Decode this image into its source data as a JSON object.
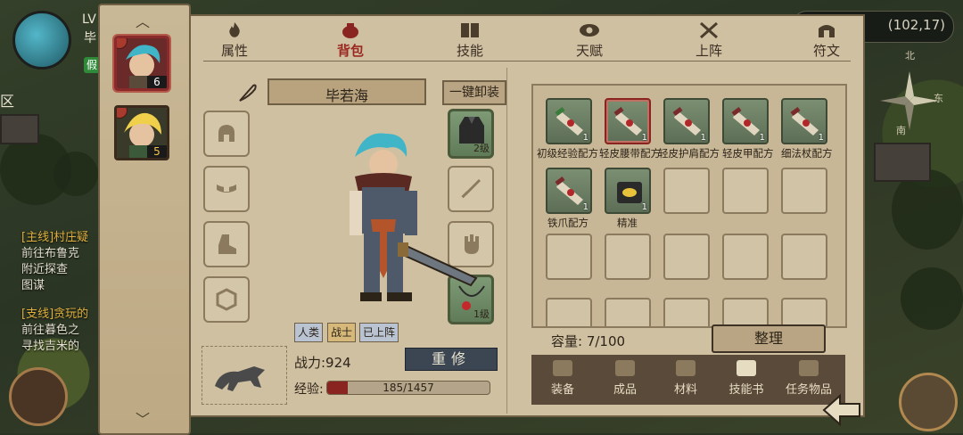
{
  "hud": {
    "level_prefix": "LV",
    "name_fragment": "毕",
    "badge": "假",
    "area": "区",
    "quests": [
      {
        "tag": "[主线]村庄疑",
        "line1": "前往布鲁克",
        "line2": "附近探查",
        "line3": "图谋"
      },
      {
        "tag": "[支线]贪玩的",
        "line1": "前往暮色之",
        "line2": "寻找吉米的"
      }
    ],
    "coords": "(102,17)",
    "compass": {
      "north": "北",
      "east": "东",
      "south": "南"
    }
  },
  "characters": [
    {
      "level": "6",
      "selected": true
    },
    {
      "level": "5",
      "selected": false
    }
  ],
  "tabs": [
    {
      "label": "属性",
      "icon": "flame-icon"
    },
    {
      "label": "背包",
      "icon": "bag-icon",
      "active": true
    },
    {
      "label": "技能",
      "icon": "book-icon"
    },
    {
      "label": "天赋",
      "icon": "eye-icon"
    },
    {
      "label": "上阵",
      "icon": "crossed-swords-icon"
    },
    {
      "label": "符文",
      "icon": "rune-gate-icon"
    }
  ],
  "hero": {
    "name": "毕若海",
    "unequip_label": "一键卸装",
    "tags": {
      "race": "人类",
      "class": "战士",
      "status": "已上阵"
    },
    "power": "战力:924",
    "reforge_label": "重修",
    "exp_label": "经验:",
    "exp_text": "185/1457",
    "exp_ratio": 0.127,
    "equipment": {
      "armor_level": "2级",
      "necklace_level": "1级"
    }
  },
  "bag": {
    "items": [
      {
        "name": "初级经验配方",
        "count": "1"
      },
      {
        "name": "轻皮腰带配方",
        "count": "1"
      },
      {
        "name": "轻皮护肩配方",
        "count": "1"
      },
      {
        "name": "轻皮甲配方",
        "count": "1"
      },
      {
        "name": "细法杖配方",
        "count": "1"
      },
      {
        "name": "铁爪配方",
        "count": "1"
      },
      {
        "name": "精准",
        "count": "1"
      }
    ],
    "capacity": "容量:  7/100",
    "sort_label": "整理",
    "categories": [
      "装备",
      "成品",
      "材料",
      "技能书",
      "任务物品"
    ],
    "active_category": "技能书"
  },
  "colors": {
    "parchment": "#cfc0a2",
    "accent_red": "#8a2420",
    "reforge_btn": "#3c4552"
  }
}
